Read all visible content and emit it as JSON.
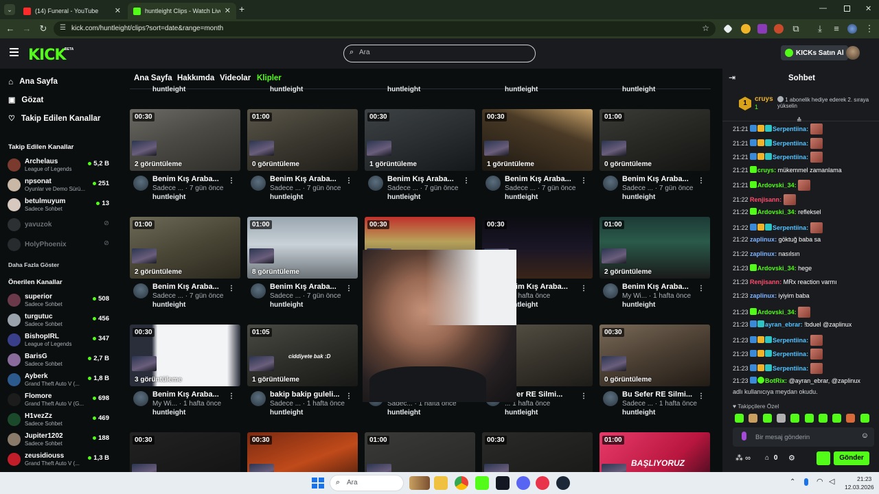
{
  "browser": {
    "tabs": [
      {
        "label": "(14) Funeral - YouTube",
        "active": false
      },
      {
        "label": "huntleight Clips - Watch Live o",
        "active": true
      }
    ],
    "url": "kick.com/huntleight/clips?sort=date&range=month"
  },
  "header": {
    "logo": "KICK",
    "logo_badge": "BETA",
    "search_placeholder": "Ara",
    "buy_kicks": "KICKs Satın Al"
  },
  "sidebar": {
    "nav": [
      "Ana Sayfa",
      "Gözat",
      "Takip Edilen Kanallar"
    ],
    "followed_title": "Takip Edilen Kanallar",
    "followed": [
      {
        "name": "Archelaus",
        "category": "League of Legends",
        "viewers": "5,2 B",
        "live": true,
        "color": "#7a3b2e"
      },
      {
        "name": "npsonat",
        "category": "Oyunlar ve Demo Sürü...",
        "viewers": "251",
        "live": true,
        "color": "#c9b8a6"
      },
      {
        "name": "betulmuyum",
        "category": "Sadece Sohbet",
        "viewers": "13",
        "live": true,
        "color": "#d7c8c0"
      },
      {
        "name": "yavuzok",
        "category": "",
        "viewers": "",
        "live": false,
        "color": "#555a5f"
      },
      {
        "name": "HolyPhoenix",
        "category": "",
        "viewers": "",
        "live": false,
        "color": "#4a4f54"
      }
    ],
    "show_more": "Daha Fazla Göster",
    "recommended_title": "Önerilen Kanallar",
    "recommended": [
      {
        "name": "superior",
        "category": "Sadece Sohbet",
        "viewers": "508",
        "color": "#6a3a4a"
      },
      {
        "name": "turgutuc",
        "category": "Sadece Sohbet",
        "viewers": "456",
        "color": "#9aa3ab"
      },
      {
        "name": "BishopIRL",
        "category": "League of Legends",
        "viewers": "347",
        "color": "#3a3f8c"
      },
      {
        "name": "BarisG",
        "category": "Sadece Sohbet",
        "viewers": "2,7 B",
        "color": "#8a6c9c"
      },
      {
        "name": "Ayberk",
        "category": "Grand Theft Auto V (...",
        "viewers": "1,8 B",
        "color": "#2d5a8c"
      },
      {
        "name": "Flomore",
        "category": "Grand Theft Auto V (G...",
        "viewers": "698",
        "color": "#1c1c1c"
      },
      {
        "name": "H1vezZz",
        "category": "Sadece Sohbet",
        "viewers": "469",
        "color": "#1a4a2a"
      },
      {
        "name": "Jupiter1202",
        "category": "Sadece Sohbet",
        "viewers": "188",
        "color": "#8a7a6a"
      },
      {
        "name": "zeusidiouss",
        "category": "Grand Theft Auto V (...",
        "viewers": "1,3 B",
        "color": "#c21e2a"
      }
    ]
  },
  "main": {
    "tabs": [
      "Ana Sayfa",
      "Hakkımda",
      "Videolar",
      "Klipler"
    ],
    "active_tab": "Klipler",
    "top_partial_user": "huntleight",
    "rows": [
      [
        {
          "duration": "00:30",
          "views": "2 görüntüleme",
          "title": "Benim Kış Araba...",
          "meta": "Sadece ... · 7 gün önce",
          "user": "huntleight",
          "bg": "linear-gradient(160deg,#6b6a63,#4b4a44 45%,#2f2e2a)"
        },
        {
          "duration": "01:00",
          "views": "0 görüntüleme",
          "title": "Benim Kış Araba...",
          "meta": "Sadece ... · 7 gün önce",
          "user": "huntleight",
          "bg": "linear-gradient(160deg,#5a564a,#3a372f 50%,#1f1d18)"
        },
        {
          "duration": "00:30",
          "views": "1 görüntüleme",
          "title": "Benim Kış Araba...",
          "meta": "Sadece ... · 7 gün önce",
          "user": "huntleight",
          "bg": "linear-gradient(160deg,#3d4244,#2a2e30 50%,#15181a)"
        },
        {
          "duration": "00:30",
          "views": "1 görüntüleme",
          "title": "Benim Kış Araba...",
          "meta": "Sadece ... · 7 gün önce",
          "user": "huntleight",
          "bg": "linear-gradient(200deg,#c9a36a,#4a3a26 35%,#1d1812)"
        },
        {
          "duration": "01:00",
          "views": "0 görüntüleme",
          "title": "Benim Kış Araba...",
          "meta": "Sadece ... · 7 gün önce",
          "user": "huntleight",
          "bg": "linear-gradient(160deg,#3a3a36,#262623 50%,#141412)"
        }
      ],
      [
        {
          "duration": "01:00",
          "views": "2 görüntüleme",
          "title": "Benim Kış Araba...",
          "meta": "Sadece ... · 7 gün önce",
          "user": "huntleight",
          "bg": "linear-gradient(160deg,#6e6a58,#4a4636 50%,#2a271d)"
        },
        {
          "duration": "01:00",
          "views": "8 görüntüleme",
          "title": "Benim Kış Araba...",
          "meta": "Sadece ... · 7 gün önce",
          "user": "huntleight",
          "bg": "linear-gradient(180deg,#9aa6b0,#c9d2d8 45%,#6a7278)"
        },
        {
          "duration": "00:30",
          "views": "",
          "title": "",
          "meta": "",
          "user": "",
          "bg": "linear-gradient(180deg,#c0302a,#b8a25a 40%,#3a3a3a)"
        },
        {
          "duration": "00:30",
          "views": "",
          "title": "...nim Kış Araba...",
          "meta": "... 1 hafta önce",
          "user": "huntleight",
          "bg": "linear-gradient(180deg,#0c0c12,#1a1626 50%,#3a2418)"
        },
        {
          "duration": "01:00",
          "views": "2 görüntüleme",
          "title": "Benim Kış Araba...",
          "meta": "My Wi... · 1 hafta önce",
          "user": "huntleight",
          "bg": "linear-gradient(180deg,#1d3a36,#2a5a4a 40%,#1a1a1a)"
        }
      ],
      [
        {
          "duration": "00:30",
          "views": "3 görüntüleme",
          "title": "Benim Kış Araba...",
          "meta": "My Wi... · 1 hafta önce",
          "user": "huntleight",
          "bg": "linear-gradient(90deg,#2a2e3a 20%,#f2f4f6 25%,#f2f4f6 88%,#2a2e3a)"
        },
        {
          "duration": "01:05",
          "views": "1 görüntüleme",
          "title": "bakip bakip guleli...",
          "meta": "Sadece ... · 1 hafta önce",
          "user": "huntleight",
          "bg": "linear-gradient(160deg,#4a4a44,#2e2e2a 50%,#181816)",
          "caption": "ciddiyete bak :D"
        },
        {
          "duration": "",
          "views": "",
          "title": "",
          "meta": "Sadec... · 1 hafta önce",
          "user": "huntleight",
          "bg": "#0b0e0f"
        },
        {
          "duration": "",
          "views": "",
          "title": "Sefer RE Silmi...",
          "meta": "... 1 hafta önce",
          "user": "huntleight",
          "bg": "linear-gradient(160deg,#5a5448,#3a362e 50%,#1e1c18)"
        },
        {
          "duration": "00:30",
          "views": "0 görüntüleme",
          "title": "Bu Sefer RE Silmi...",
          "meta": "Sadece ... · 1 hafta önce",
          "user": "huntleight",
          "bg": "linear-gradient(160deg,#7a6a58,#4a3e32 50%,#221c16)"
        }
      ],
      [
        {
          "duration": "00:30",
          "bg": "linear-gradient(160deg,#222,#111)"
        },
        {
          "duration": "00:30",
          "bg": "linear-gradient(160deg,#7a2a12,#c04a1a 50%,#2a1008)"
        },
        {
          "duration": "01:00",
          "bg": "linear-gradient(160deg,#3a3a38,#242422)"
        },
        {
          "duration": "00:30",
          "bg": "linear-gradient(160deg,#2a2a28,#161614)"
        },
        {
          "duration": "01:00",
          "bg": "linear-gradient(135deg,#e83a6a,#b8163e 60%,#2a0a18)",
          "caption": "BAŞLIYORUZ"
        }
      ]
    ]
  },
  "chat": {
    "title": "Sohbet",
    "top_gifter": {
      "rank": "1",
      "name": "cruys",
      "count": "1"
    },
    "gift_hint": "1 abonelik hediye ederek 2. sıraya yükselin",
    "messages": [
      {
        "time": "21:21",
        "user": "Serpentiina",
        "color": "#52c3ff",
        "text": "",
        "emote": true
      },
      {
        "time": "21:21",
        "user": "Serpentiina",
        "color": "#52c3ff",
        "text": "",
        "emote": true
      },
      {
        "time": "21:21",
        "user": "Serpentiina",
        "color": "#52c3ff",
        "text": "",
        "emote": true
      },
      {
        "time": "21:21",
        "user": "cruys",
        "color": "#53fc18",
        "text": "mükemmel zamanlama",
        "emote": false
      },
      {
        "time": "21:21",
        "user": "Ardovski_34",
        "color": "#53fc18",
        "text": "",
        "emote": true
      },
      {
        "time": "21:22",
        "user": "Renjisann",
        "color": "#ff4d6d",
        "text": "",
        "emote": true
      },
      {
        "time": "21:22",
        "user": "Ardovski_34",
        "color": "#53fc18",
        "text": "refleksel",
        "emote": false
      },
      {
        "time": "21:22",
        "user": "Serpentiina",
        "color": "#52c3ff",
        "text": "",
        "emote": true
      },
      {
        "time": "21:22",
        "user": "zaplinux",
        "color": "#7fb3ff",
        "text": "göktuğ baba sa",
        "emote": false
      },
      {
        "time": "21:22",
        "user": "zaplinux",
        "color": "#7fb3ff",
        "text": "nasılsın",
        "emote": false
      },
      {
        "time": "21:23",
        "user": "Ardovski_34",
        "color": "#53fc18",
        "text": "hege",
        "emote": false
      },
      {
        "time": "21:23",
        "user": "Renjisann",
        "color": "#ff4d6d",
        "text": "MRx reaction varmı",
        "emote": false
      },
      {
        "time": "21:23",
        "user": "zaplinux",
        "color": "#7fb3ff",
        "text": "iyiyim baba",
        "emote": false
      },
      {
        "time": "21:23",
        "user": "Ardovski_34",
        "color": "#53fc18",
        "text": "",
        "emote": true
      },
      {
        "time": "21:23",
        "user": "ayran_ebrar",
        "color": "#52c3ff",
        "text": "!bduel @zaplinux",
        "emote": false
      },
      {
        "time": "21:23",
        "user": "Serpentiina",
        "color": "#52c3ff",
        "text": "",
        "emote": true
      },
      {
        "time": "21:23",
        "user": "Serpentiina",
        "color": "#52c3ff",
        "text": "",
        "emote": true
      },
      {
        "time": "21:23",
        "user": "Serpentiina",
        "color": "#52c3ff",
        "text": "",
        "emote": true
      },
      {
        "time": "21:23",
        "user": "BotRix",
        "color": "#53fc18",
        "text": "@ayran_ebrar, @zaplinux",
        "emote": false
      }
    ],
    "botrix_line2": "adlı kullanıcıya meydan okudu.",
    "follower_label": "Takipçilere Özel",
    "input_placeholder": "Bir mesaj gönderin",
    "points": "0",
    "send_label": "Gönder"
  },
  "taskbar": {
    "search_placeholder": "Ara",
    "time": "21:23",
    "date": "12.03.2026"
  }
}
